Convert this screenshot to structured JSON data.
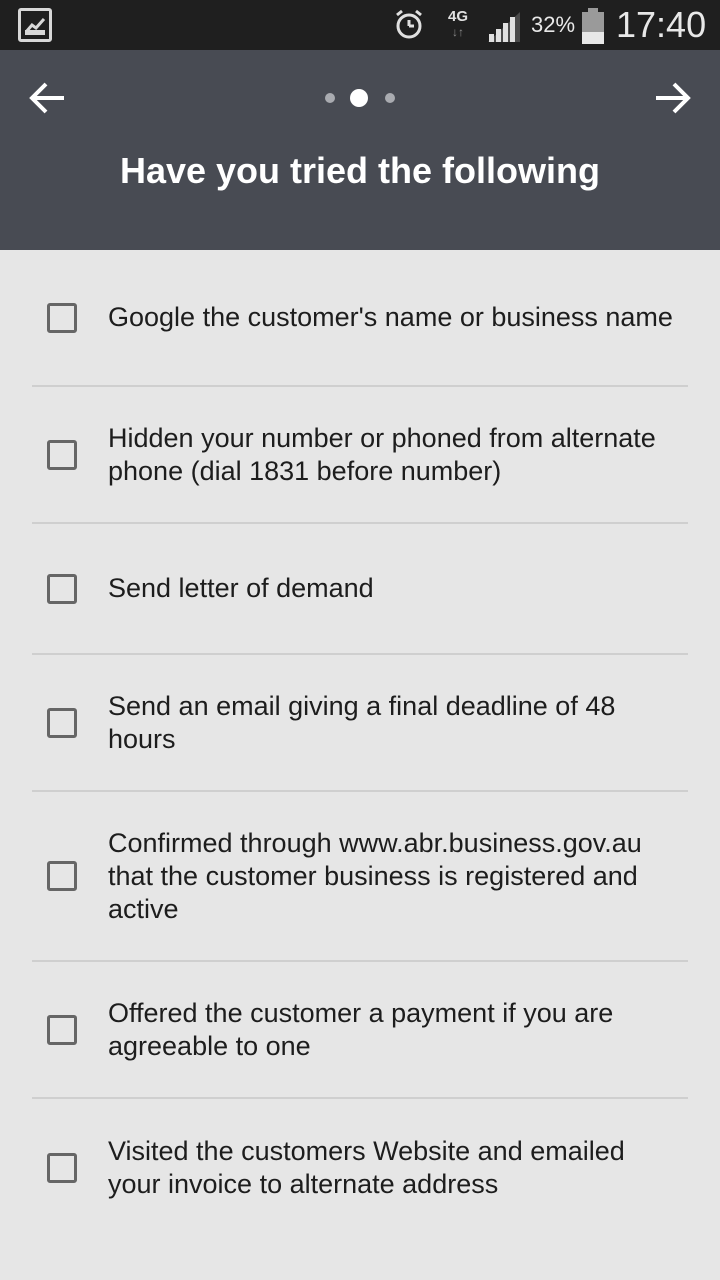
{
  "status_bar": {
    "left_icon": "gallery-notification-icon",
    "alarm_icon": "alarm-clock-icon",
    "network": "4G",
    "network_arrows": "↓↑",
    "signal_icon": "signal-strength-icon",
    "battery_percent": "32%",
    "battery_icon": "battery-icon",
    "time": "17:40"
  },
  "header": {
    "back_icon": "arrow-left-icon",
    "next_icon": "arrow-right-icon",
    "page_indicator": {
      "total": 3,
      "current": 2
    },
    "title": "Have you tried the following"
  },
  "checklist": {
    "items": [
      {
        "label": "Google the customer's name or business name",
        "checked": false
      },
      {
        "label": "Hidden your number or phoned from alternate phone (dial 1831 before number)",
        "checked": false
      },
      {
        "label": "Send letter of demand",
        "checked": false
      },
      {
        "label": "Send an email giving a final deadline of 48 hours",
        "checked": false
      },
      {
        "label": "Confirmed through www.abr.business.gov.au that the customer business is registered and active",
        "checked": false
      },
      {
        "label": "Offered the customer a payment if you are agreeable to one",
        "checked": false
      },
      {
        "label": "Visited the customers Website and emailed your invoice to alternate address",
        "checked": false
      }
    ]
  },
  "colors": {
    "status_bar_bg": "#1f1f1f",
    "header_bg": "#484b53",
    "body_bg": "#e6e6e6",
    "divider": "#cfcfcf",
    "checkbox_border": "#666666",
    "text": "#1d1d1d",
    "title_text": "#ffffff"
  }
}
